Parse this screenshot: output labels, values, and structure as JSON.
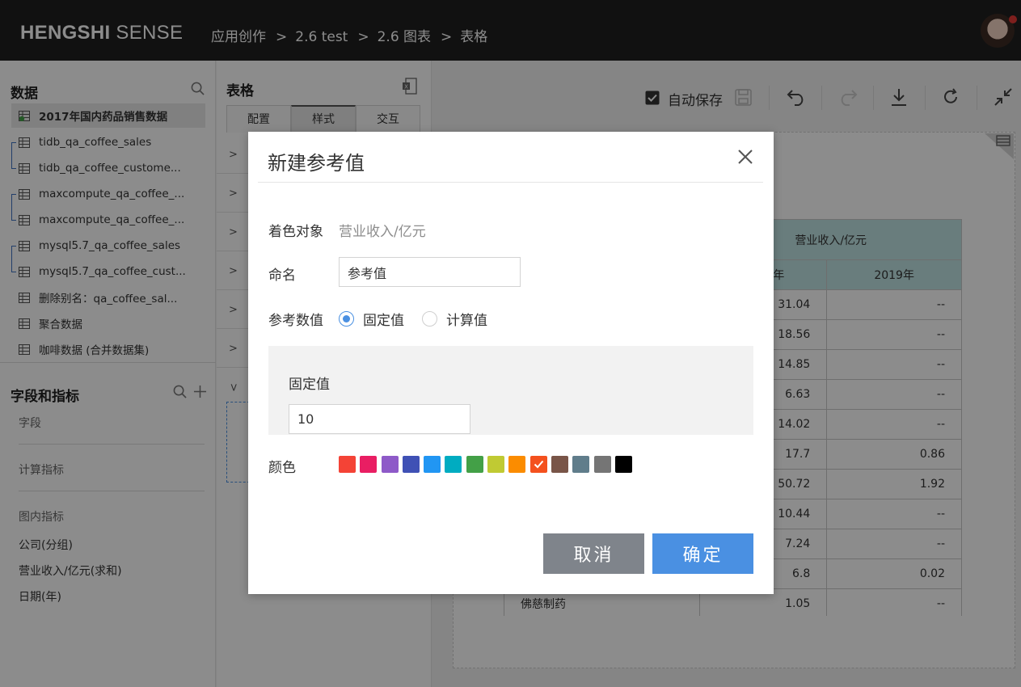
{
  "header": {
    "logo_bold": "HENGSHI",
    "logo_light": "SENSE",
    "breadcrumb": [
      "应用创作",
      "2.6 test",
      "2.6 图表",
      "表格"
    ],
    "separator": ">"
  },
  "data_panel": {
    "title": "数据",
    "datasets": [
      {
        "label": "2017年国内药品销售数据",
        "active": true
      },
      {
        "label": "tidb_qa_coffee_sales"
      },
      {
        "label": "tidb_qa_coffee_custome..."
      },
      {
        "label": "maxcompute_qa_coffee_..."
      },
      {
        "label": "maxcompute_qa_coffee_..."
      },
      {
        "label": "mysql5.7_qa_coffee_sales"
      },
      {
        "label": "mysql5.7_qa_coffee_cust..."
      },
      {
        "label": "删除别名：qa_coffee_sal..."
      },
      {
        "label": "聚合数据"
      },
      {
        "label": "咖啡数据 (合并数据集)"
      }
    ]
  },
  "fields_panel": {
    "title": "字段和指标",
    "fields_label": "字段",
    "calc_label": "计算指标",
    "chart_metrics_label": "图内指标",
    "chart_metrics": [
      "公司(分组)",
      "营业收入/亿元(求和)",
      "日期(年)"
    ]
  },
  "config_panel": {
    "title": "表格",
    "tabs": [
      {
        "label": "配置",
        "active": false
      },
      {
        "label": "样式",
        "active": true
      },
      {
        "label": "交互",
        "active": false
      }
    ]
  },
  "toolbar": {
    "autosave_label": "自动保存",
    "autosave_checked": true
  },
  "table": {
    "header_top": "营业收入/亿元",
    "header_cols": [
      "年",
      "2019年"
    ],
    "rows": [
      [
        "",
        "31.04",
        "--"
      ],
      [
        "",
        "18.56",
        "--"
      ],
      [
        "",
        "14.85",
        "--"
      ],
      [
        "",
        "6.63",
        "--"
      ],
      [
        "",
        "14.02",
        "--"
      ],
      [
        "",
        "17.7",
        "0.86"
      ],
      [
        "",
        "50.72",
        "1.92"
      ],
      [
        "",
        "10.44",
        "--"
      ],
      [
        "",
        "7.24",
        "--"
      ],
      [
        "",
        "6.8",
        "0.02"
      ],
      [
        "佛慈制药",
        "1.05",
        "--"
      ]
    ]
  },
  "modal": {
    "title": "新建参考值",
    "color_target_label": "着色对象",
    "color_target_value": "营业收入/亿元",
    "name_label": "命名",
    "name_value": "参考值",
    "ref_value_label": "参考数值",
    "radio_fixed": "固定值",
    "radio_calc": "计算值",
    "fixed_label": "固定值",
    "fixed_value": "10",
    "color_label": "颜色",
    "colors": [
      "#f44336",
      "#e91e63",
      "#8e5ac8",
      "#3f51b5",
      "#2196f3",
      "#00acc1",
      "#43a047",
      "#c0ca33",
      "#fb8c00",
      "#f4511e",
      "#795548",
      "#607d8b",
      "#757575",
      "#000000"
    ],
    "selected_color_index": 9,
    "cancel_label": "取消",
    "ok_label": "确定"
  }
}
